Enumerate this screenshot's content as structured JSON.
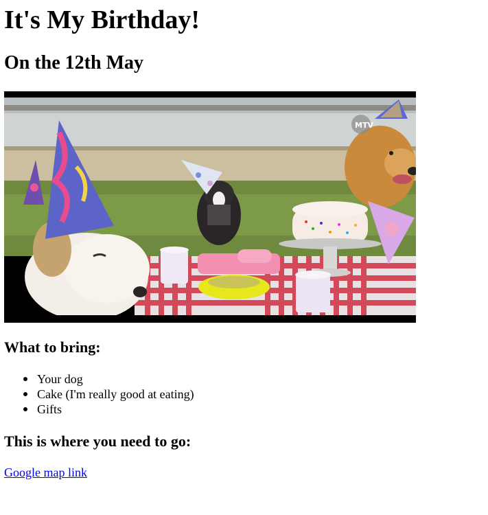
{
  "page": {
    "title": "It's My Birthday!",
    "subtitle": "On the 12th May"
  },
  "image": {
    "icon": "birthday-party-dogs-photo",
    "watermark": "MTV"
  },
  "bring": {
    "heading": "What to bring:",
    "items": [
      "Your dog",
      "Cake (I'm really good at eating)",
      "Gifts"
    ]
  },
  "directions": {
    "heading": "This is where you need to go:",
    "link_text": "Google map link"
  },
  "colors": {
    "link": "#0000ee",
    "text": "#000000",
    "background": "#ffffff"
  }
}
